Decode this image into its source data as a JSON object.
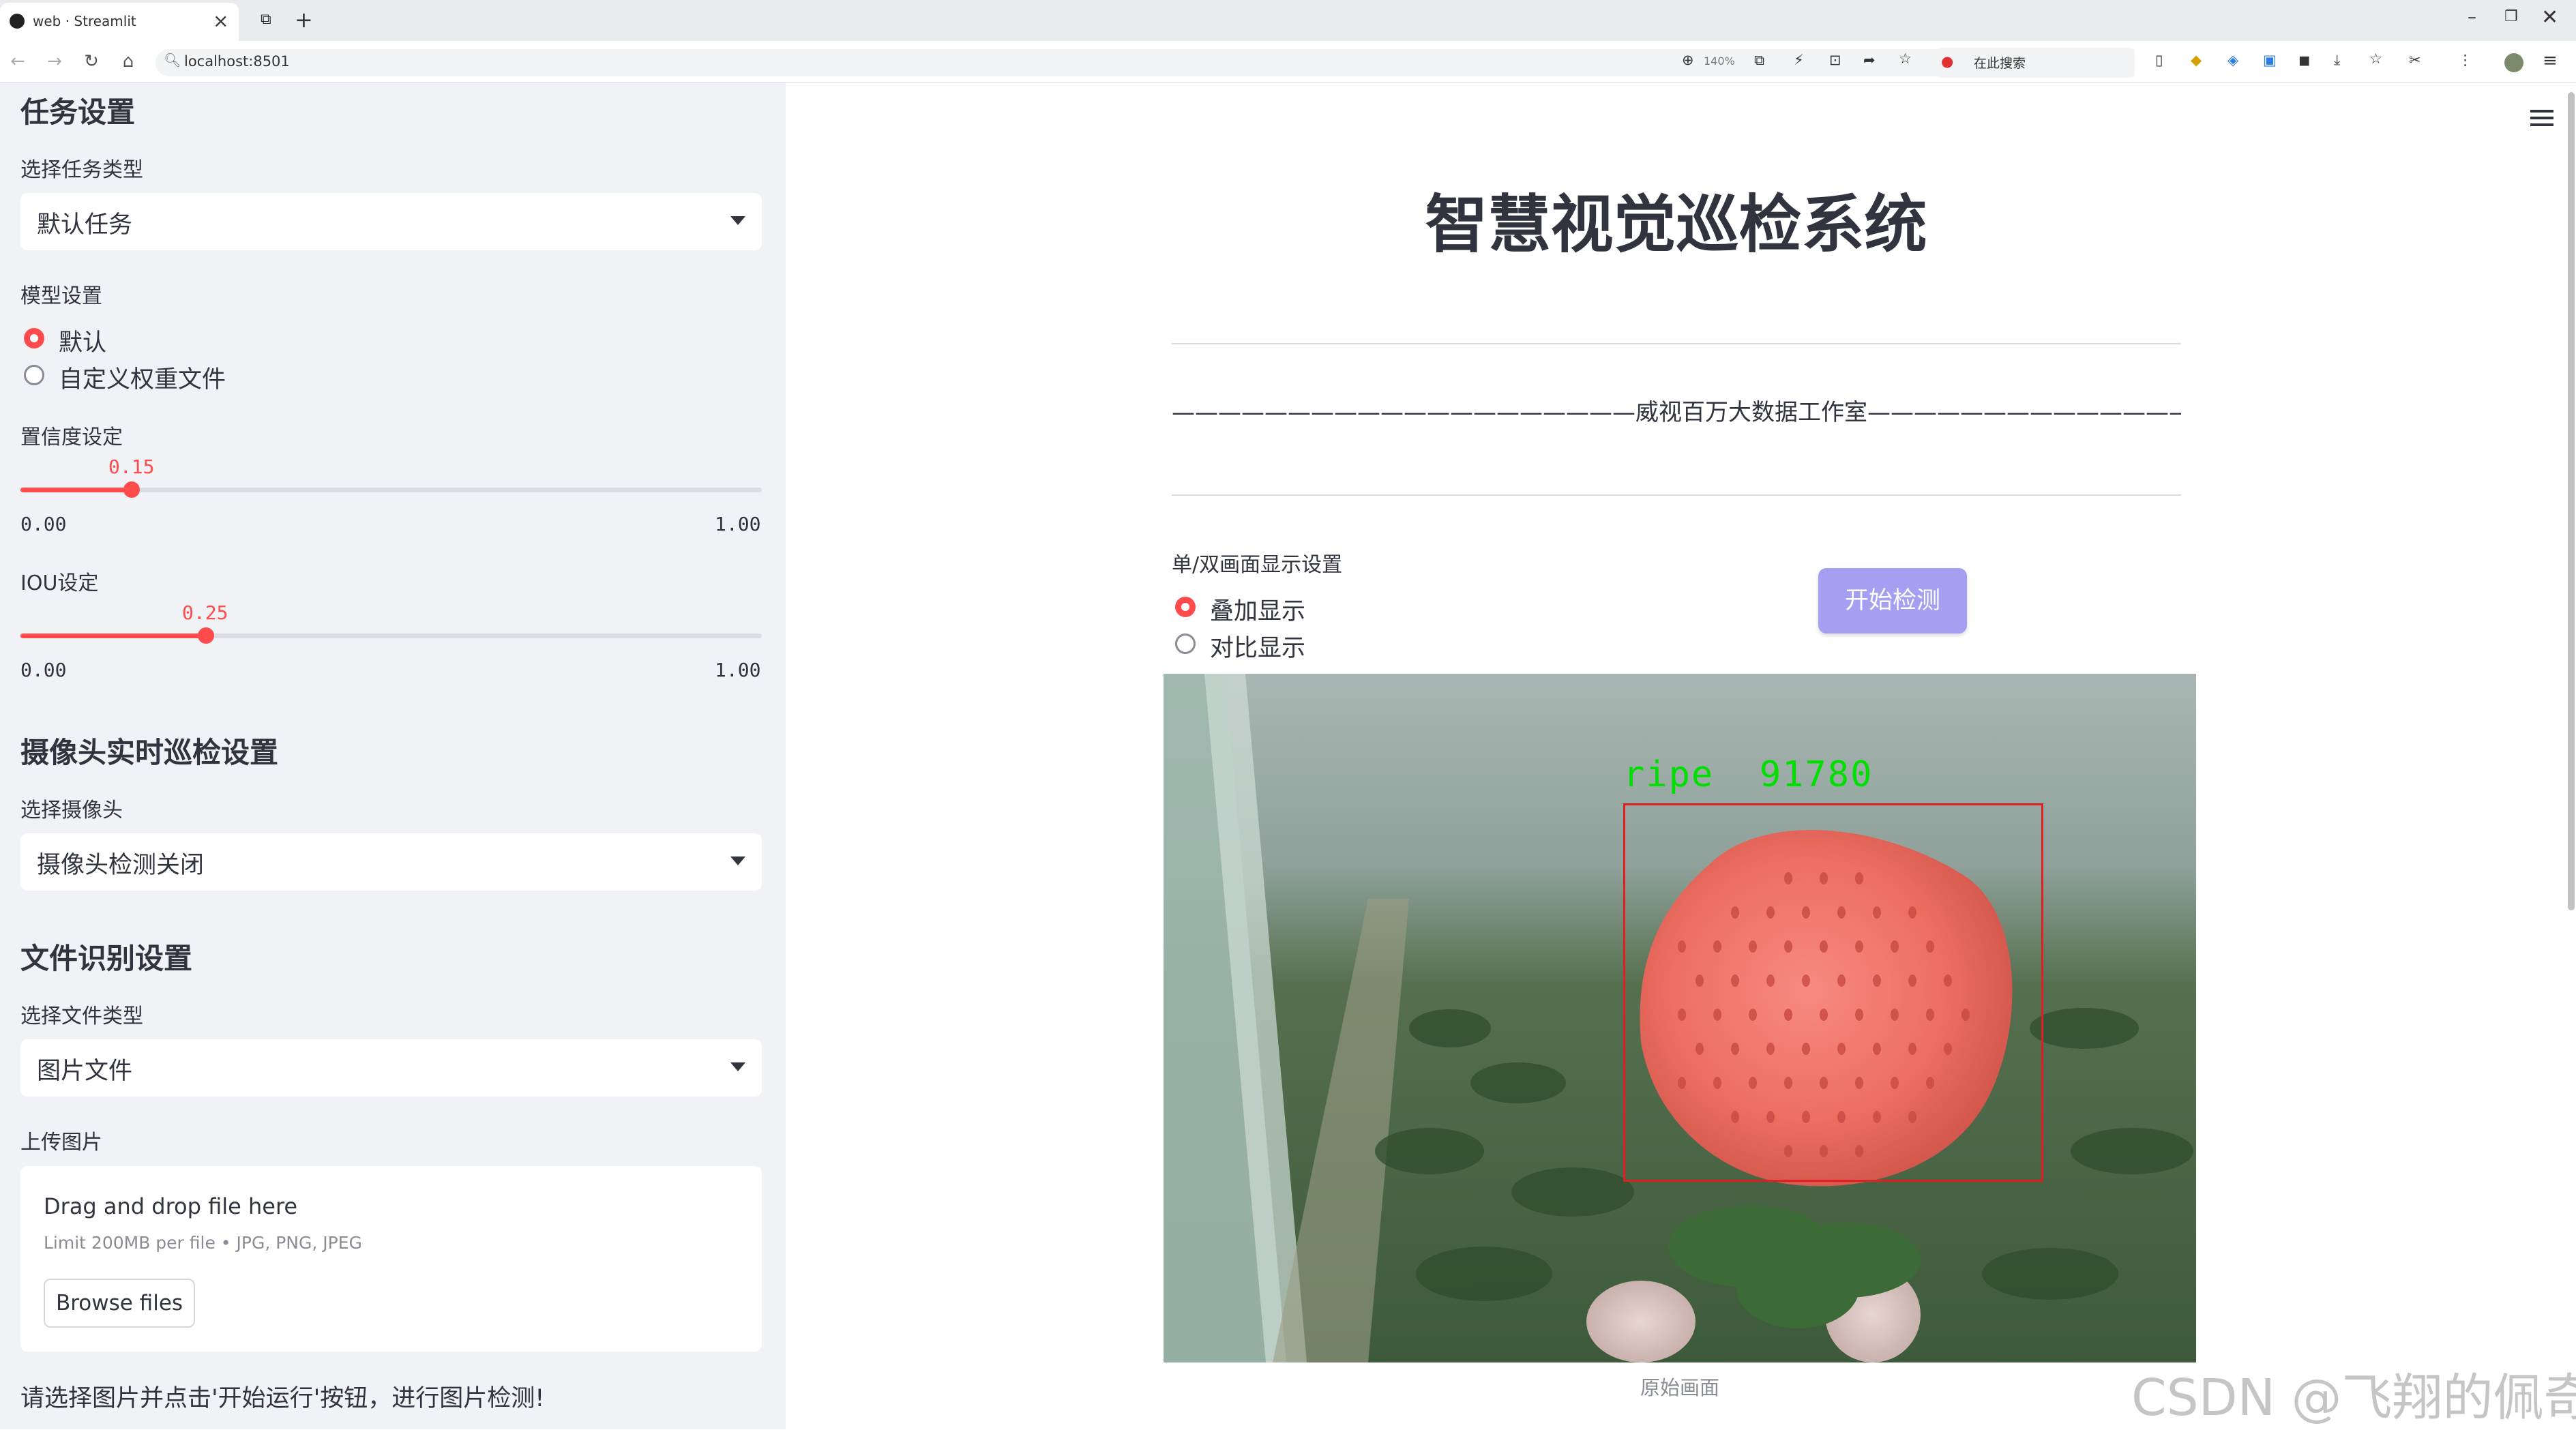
{
  "browser": {
    "tab_title": "web · Streamlit",
    "url": "localhost:8501",
    "zoom": "140%",
    "search_placeholder": "在此搜索",
    "close_glyph": "×",
    "new_tab_glyph": "+"
  },
  "sidebar": {
    "task_settings": {
      "heading": "任务设置",
      "select_label": "选择任务类型",
      "select_value": "默认任务"
    },
    "model_settings": {
      "label": "模型设置",
      "options": [
        "默认",
        "自定义权重文件"
      ],
      "selected_index": 0
    },
    "confidence": {
      "label": "置信度设定",
      "value": "0.15",
      "fraction": 0.15,
      "min": "0.00",
      "max": "1.00"
    },
    "iou": {
      "label": "IOU设定",
      "value": "0.25",
      "fraction": 0.25,
      "min": "0.00",
      "max": "1.00"
    },
    "camera": {
      "heading": "摄像头实时巡检设置",
      "select_label": "选择摄像头",
      "select_value": "摄像头检测关闭"
    },
    "file": {
      "heading": "文件识别设置",
      "select_label": "选择文件类型",
      "select_value": "图片文件",
      "upload_label": "上传图片",
      "drop_text": "Drag and drop file here",
      "limit_text": "Limit 200MB per file • JPG, PNG, JPEG",
      "browse_label": "Browse files",
      "hint": "请选择图片并点击'开始运行'按钮，进行图片检测!"
    }
  },
  "main": {
    "title": "智慧视觉巡检系统",
    "banner": "————————————————————威视百万大数据工作室———————————————————————",
    "display_label": "单/双画面显示设置",
    "display_options": [
      "叠加显示",
      "对比显示"
    ],
    "display_selected_index": 0,
    "start_button": "开始检测",
    "detection_label": "ripe  91780",
    "image_caption": "原始画面"
  },
  "watermark": "CSDN @飞翔的佩奇",
  "colors": {
    "accent": "#ff4b4b",
    "button": "#a49ff0",
    "sidebar_bg": "#f0f2f6",
    "detection_text": "#00e000",
    "detection_box": "#e02020"
  }
}
